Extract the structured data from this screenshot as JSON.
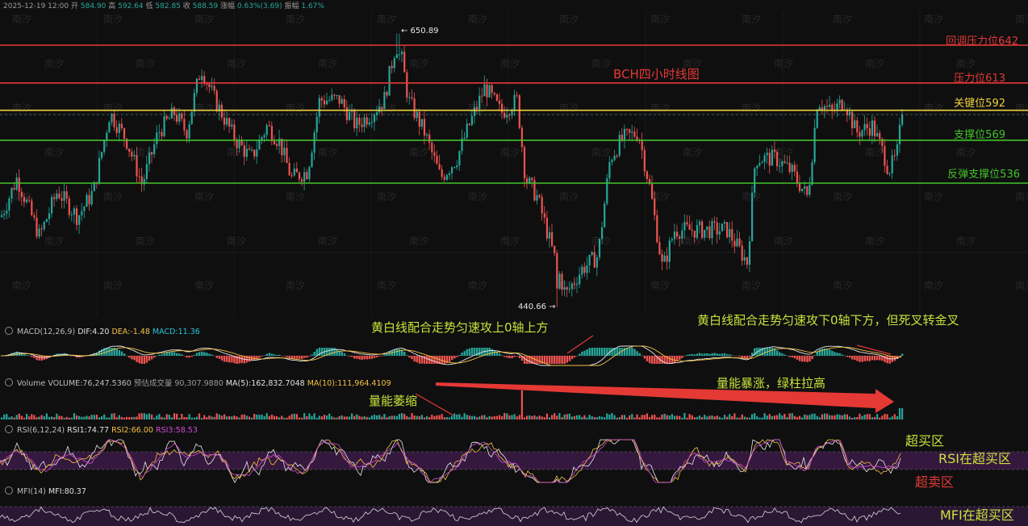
{
  "header": {
    "date": "2025-12-19 12:00",
    "open_label": "开",
    "open": "584.90",
    "high_label": "高",
    "high": "592.64",
    "low_label": "低",
    "low": "582.85",
    "close_label": "收",
    "close": "588.59",
    "change_label": "涨幅",
    "change": "0.63%(3.69)",
    "amp_label": "振幅",
    "amp": "1.67%"
  },
  "title": "BCH四小时线图",
  "watermark": "南汐",
  "colors": {
    "up": "#26a69a",
    "down": "#ef5350",
    "red_level": "#e53935",
    "yellow_level": "#f0d23a",
    "green_level": "#43c32a",
    "note": "#c8e23a"
  },
  "levels": [
    {
      "label": "回调压力位642",
      "price": 642,
      "color": "red"
    },
    {
      "label": "压力位613",
      "price": 613,
      "color": "red"
    },
    {
      "label": "关键位592",
      "price": 592,
      "color": "yellow"
    },
    {
      "label": "支撑位569",
      "price": 569,
      "color": "green"
    },
    {
      "label": "反弹支撑位536",
      "price": 536,
      "color": "green"
    }
  ],
  "price_marks": {
    "high": "← 650.89",
    "low": "440.66 →"
  },
  "macd": {
    "name": "MACD(12,26,9)",
    "dif": "DIF:4.20",
    "dea": "DEA:-1.48",
    "macd": "MACD:11.36"
  },
  "volume": {
    "name": "Volume",
    "vol": "VOLUME:76,247.5360",
    "est": "预估成交量 90,307.9880",
    "ma5": "MA(5):162,832.7048",
    "ma10": "MA(10):111,964.4109"
  },
  "rsi": {
    "name": "RSI(6,12,24)",
    "rsi1": "RSI1:74.77",
    "rsi2": "RSI2:66.00",
    "rsi3": "RSI3:58.53"
  },
  "mfi": {
    "name": "MFI(14)",
    "mfi": "MFI:80.37"
  },
  "notes": {
    "macd_left": "黄白线配合走势匀速攻上0轴上方",
    "macd_right": "黄白线配合走势匀速攻下0轴下方，但死叉转金叉",
    "vol_left": "量能萎缩",
    "vol_right": "量能暴涨，绿柱拉高",
    "overbought": "超买区",
    "rsi_overbought": "RSI在超买区",
    "oversold": "超卖区",
    "mfi_overbought": "MFI在超买区"
  },
  "chart_data": {
    "type": "candlestick",
    "title": "BCH四小时线图",
    "ylim": [
      438,
      654
    ],
    "key_points": {
      "high": 650.89,
      "low": 440.66,
      "last_close": 588.59
    },
    "anchors": [
      [
        0,
        510
      ],
      [
        20,
        540
      ],
      [
        48,
        495
      ],
      [
        70,
        530
      ],
      [
        95,
        510
      ],
      [
        115,
        530
      ],
      [
        135,
        590
      ],
      [
        155,
        570
      ],
      [
        175,
        535
      ],
      [
        195,
        575
      ],
      [
        215,
        590
      ],
      [
        230,
        575
      ],
      [
        248,
        625
      ],
      [
        265,
        600
      ],
      [
        290,
        570
      ],
      [
        310,
        555
      ],
      [
        330,
        580
      ],
      [
        345,
        568
      ],
      [
        360,
        540
      ],
      [
        380,
        545
      ],
      [
        395,
        600
      ],
      [
        420,
        600
      ],
      [
        440,
        580
      ],
      [
        460,
        590
      ],
      [
        475,
        600
      ],
      [
        492,
        650
      ],
      [
        505,
        600
      ],
      [
        525,
        575
      ],
      [
        545,
        540
      ],
      [
        565,
        555
      ],
      [
        580,
        580
      ],
      [
        600,
        610
      ],
      [
        620,
        590
      ],
      [
        640,
        600
      ],
      [
        650,
        540
      ],
      [
        665,
        525
      ],
      [
        690,
        470
      ],
      [
        700,
        450
      ],
      [
        720,
        470
      ],
      [
        740,
        480
      ],
      [
        755,
        555
      ],
      [
        770,
        570
      ],
      [
        790,
        575
      ],
      [
        805,
        530
      ],
      [
        820,
        470
      ],
      [
        835,
        500
      ],
      [
        855,
        500
      ],
      [
        875,
        500
      ],
      [
        900,
        500
      ],
      [
        925,
        475
      ],
      [
        935,
        555
      ],
      [
        960,
        555
      ],
      [
        980,
        545
      ],
      [
        1000,
        525
      ],
      [
        1012,
        600
      ],
      [
        1030,
        590
      ],
      [
        1045,
        600
      ],
      [
        1060,
        575
      ],
      [
        1080,
        580
      ],
      [
        1096,
        555
      ],
      [
        1100,
        546
      ],
      [
        1110,
        556
      ],
      [
        1116,
        585
      ],
      [
        1118,
        589
      ]
    ]
  }
}
